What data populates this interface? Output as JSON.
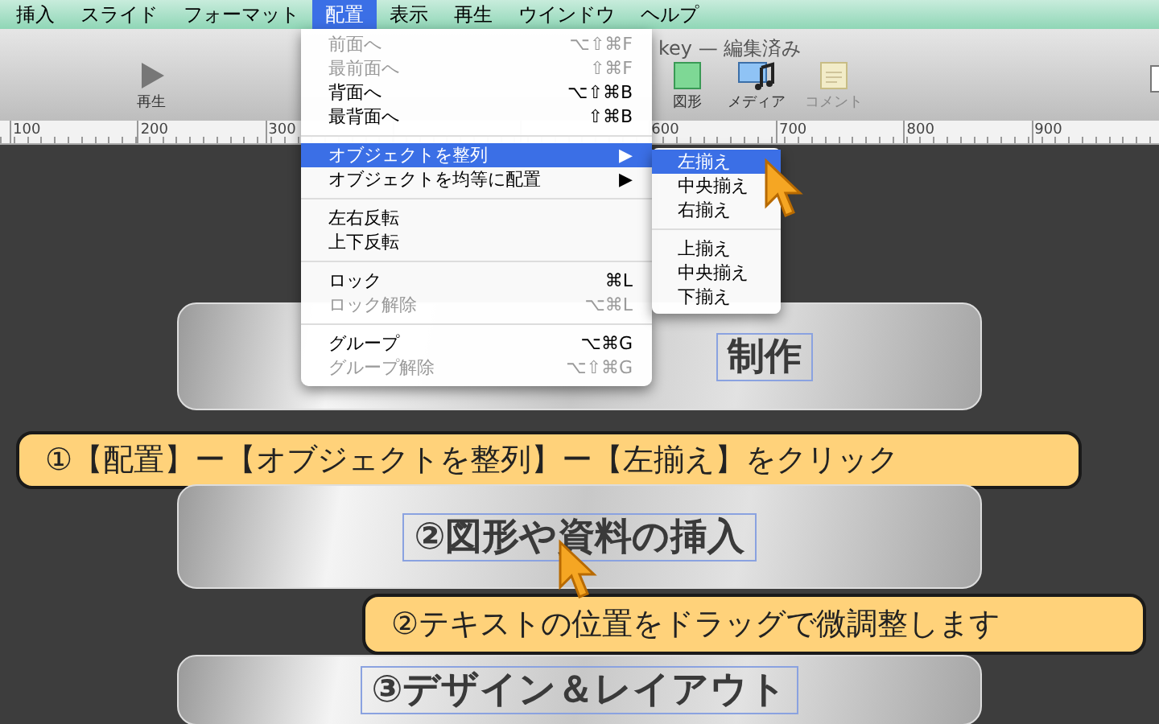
{
  "menubar": [
    {
      "label": "挿入",
      "selected": false
    },
    {
      "label": "スライド",
      "selected": false
    },
    {
      "label": "フォーマット",
      "selected": false
    },
    {
      "label": "配置",
      "selected": true
    },
    {
      "label": "表示",
      "selected": false
    },
    {
      "label": "再生",
      "selected": false
    },
    {
      "label": "ウインドウ",
      "selected": false
    },
    {
      "label": "ヘルプ",
      "selected": false
    }
  ],
  "window": {
    "title": "key — 編集済み"
  },
  "toolbar": [
    {
      "kind": "play",
      "label": "再生",
      "disabled": false
    },
    {
      "kind": "shape",
      "label": "図形",
      "disabled": false
    },
    {
      "kind": "media",
      "label": "メディア",
      "disabled": false
    },
    {
      "kind": "comment",
      "label": "コメント",
      "disabled": true
    }
  ],
  "ruler": {
    "left_labels": [
      "100",
      "200",
      "300"
    ],
    "right_labels": [
      "600",
      "700",
      "800",
      "900"
    ]
  },
  "menu": [
    {
      "kind": "item",
      "label": "前面へ",
      "shortcut": "⌥⇧⌘F",
      "disabled": true,
      "selected": false
    },
    {
      "kind": "item",
      "label": "最前面へ",
      "shortcut": "⇧⌘F",
      "disabled": true,
      "selected": false
    },
    {
      "kind": "item",
      "label": "背面へ",
      "shortcut": "⌥⇧⌘B",
      "disabled": false,
      "selected": false
    },
    {
      "kind": "item",
      "label": "最背面へ",
      "shortcut": "⇧⌘B",
      "disabled": false,
      "selected": false
    },
    {
      "kind": "separator"
    },
    {
      "kind": "submenu",
      "label": "オブジェクトを整列",
      "shortcut": "▶",
      "disabled": false,
      "selected": true
    },
    {
      "kind": "submenu",
      "label": "オブジェクトを均等に配置",
      "shortcut": "▶",
      "disabled": false,
      "selected": false
    },
    {
      "kind": "separator"
    },
    {
      "kind": "item",
      "label": "左右反転",
      "disabled": false,
      "selected": false
    },
    {
      "kind": "item",
      "label": "上下反転",
      "disabled": false,
      "selected": false
    },
    {
      "kind": "separator"
    },
    {
      "kind": "item",
      "label": "ロック",
      "shortcut": "⌘L",
      "disabled": false,
      "selected": false
    },
    {
      "kind": "item",
      "label": "ロック解除",
      "shortcut": "⌥⌘L",
      "disabled": true,
      "selected": false
    },
    {
      "kind": "separator"
    },
    {
      "kind": "item",
      "label": "グループ",
      "shortcut": "⌥⌘G",
      "disabled": false,
      "selected": false
    },
    {
      "kind": "item",
      "label": "グループ解除",
      "shortcut": "⌥⇧⌘G",
      "disabled": true,
      "selected": false
    }
  ],
  "submenu": [
    {
      "kind": "item",
      "label": "左揃え",
      "selected": true
    },
    {
      "kind": "item",
      "label": "中央揃え",
      "selected": false
    },
    {
      "kind": "item",
      "label": "右揃え",
      "selected": false
    },
    {
      "kind": "separator"
    },
    {
      "kind": "item",
      "label": "上揃え",
      "selected": false
    },
    {
      "kind": "item",
      "label": "中央揃え",
      "selected": false
    },
    {
      "kind": "item",
      "label": "下揃え",
      "selected": false
    }
  ],
  "slides": [
    {
      "kind": "partial",
      "text": "制作"
    },
    {
      "kind": "full",
      "text": "②図形や資料の挿入"
    },
    {
      "kind": "full",
      "text": "③デザイン＆レイアウト"
    }
  ],
  "callouts": [
    "①【配置】ー【オブジェクトを整列】ー【左揃え】をクリック",
    "②テキストの位置をドラッグで微調整します"
  ]
}
